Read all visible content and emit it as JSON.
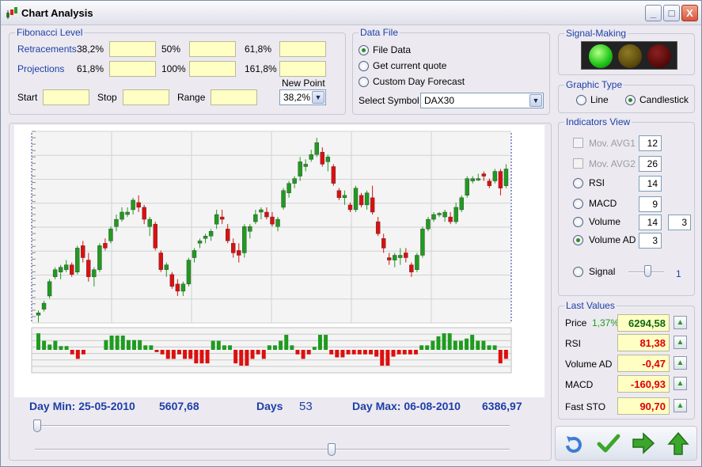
{
  "window": {
    "title": "Chart Analysis",
    "minimize": "_",
    "maximize": "□",
    "close": "X"
  },
  "fibonacci": {
    "legend": "Fibonacci Level",
    "retracements_label": "Retracements",
    "retracements": [
      "38,2%",
      "50%",
      "61,8%"
    ],
    "projections_label": "Projections",
    "projections": [
      "61,8%",
      "100%",
      "161,8%"
    ],
    "start_label": "Start",
    "stop_label": "Stop",
    "range_label": "Range",
    "new_point_label": "New Point",
    "new_point_value": "38,2%"
  },
  "data_file": {
    "legend": "Data File",
    "options": [
      "File Data",
      "Get current quote",
      "Custom Day Forecast"
    ],
    "selected": 0,
    "symbol_label": "Select Symbol",
    "symbol_value": "DAX30"
  },
  "signal": {
    "legend": "Signal-Making",
    "lights": [
      "green-on",
      "yellow-off",
      "red-off"
    ]
  },
  "graphic_type": {
    "legend": "Graphic Type",
    "options": [
      "Line",
      "Candlestick"
    ],
    "selected": 1
  },
  "indicators": {
    "legend": "Indicators View",
    "items": [
      {
        "label": "Mov. AVG1",
        "kind": "check",
        "value": "12",
        "enabled": false
      },
      {
        "label": "Mov. AVG2",
        "kind": "check",
        "value": "26",
        "enabled": false
      },
      {
        "label": "RSI",
        "kind": "radio",
        "value": "14"
      },
      {
        "label": "MACD",
        "kind": "radio",
        "value": "9"
      },
      {
        "label": "Volume",
        "kind": "radio",
        "value": "14",
        "value2": "3"
      },
      {
        "label": "Volume AD",
        "kind": "radio",
        "value": "3",
        "selected": true
      }
    ],
    "signal_label": "Signal",
    "signal_value": "1",
    "signal_level": 0.55
  },
  "last_values": {
    "legend": "Last Values",
    "price_label": "Price",
    "price_change": "1,37%",
    "price": "6294,58",
    "rsi_label": "RSI",
    "rsi": "81,38",
    "vad_label": "Volume AD",
    "vad": "-0,47",
    "macd_label": "MACD",
    "macd": "-160,93",
    "fsto_label": "Fast STO",
    "fsto": "90,70"
  },
  "stats": {
    "day_min": "Day Min: 25-05-2010",
    "min_value": "5607,68",
    "days_label": "Days",
    "days": "53",
    "day_max": "Day Max: 06-08-2010",
    "max_value": "6386,97"
  },
  "sliders": {
    "range_start": 0.0,
    "range_end": 0.63
  },
  "colors": {
    "up": "#1f9b1f",
    "down": "#dd0f0f",
    "accent": "#1e3ea8",
    "field": "#ffffc4"
  },
  "chart_data": {
    "type": "candlestick",
    "ylim": [
      5607.68,
      6386.97
    ],
    "candles": [
      [
        5640,
        5660,
        5610,
        5650
      ],
      [
        5665,
        5700,
        5655,
        5690
      ],
      [
        5720,
        5790,
        5710,
        5780
      ],
      [
        5800,
        5840,
        5790,
        5830
      ],
      [
        5820,
        5850,
        5790,
        5840
      ],
      [
        5830,
        5870,
        5820,
        5850
      ],
      [
        5850,
        5860,
        5800,
        5810
      ],
      [
        5820,
        5930,
        5810,
        5920
      ],
      [
        5930,
        5950,
        5860,
        5880
      ],
      [
        5870,
        5900,
        5780,
        5800
      ],
      [
        5800,
        5840,
        5760,
        5830
      ],
      [
        5830,
        5940,
        5820,
        5930
      ],
      [
        5940,
        5960,
        5910,
        5920
      ],
      [
        5950,
        6010,
        5940,
        6000
      ],
      [
        6010,
        6060,
        5990,
        6040
      ],
      [
        6040,
        6090,
        6030,
        6070
      ],
      [
        6060,
        6090,
        6050,
        6070
      ],
      [
        6080,
        6130,
        6060,
        6120
      ],
      [
        6110,
        6140,
        6070,
        6090
      ],
      [
        6090,
        6100,
        6020,
        6040
      ],
      [
        6010,
        6050,
        5970,
        6040
      ],
      [
        6020,
        6030,
        5910,
        5920
      ],
      [
        5900,
        5910,
        5820,
        5830
      ],
      [
        5830,
        5860,
        5800,
        5850
      ],
      [
        5810,
        5820,
        5750,
        5760
      ],
      [
        5770,
        5790,
        5720,
        5740
      ],
      [
        5740,
        5780,
        5720,
        5770
      ],
      [
        5770,
        5880,
        5760,
        5870
      ],
      [
        5880,
        5920,
        5860,
        5910
      ],
      [
        5940,
        5960,
        5920,
        5950
      ],
      [
        5960,
        5980,
        5940,
        5970
      ],
      [
        5970,
        6000,
        5950,
        5990
      ],
      [
        6020,
        6080,
        6000,
        6060
      ],
      [
        6050,
        6080,
        6020,
        6040
      ],
      [
        6000,
        6020,
        5940,
        5950
      ],
      [
        5940,
        5960,
        5880,
        5900
      ],
      [
        5910,
        5940,
        5860,
        5890
      ],
      [
        5900,
        6020,
        5880,
        6010
      ],
      [
        5990,
        6020,
        5960,
        6010
      ],
      [
        6030,
        6080,
        6020,
        6060
      ],
      [
        6070,
        6090,
        6040,
        6080
      ],
      [
        6070,
        6090,
        6040,
        6050
      ],
      [
        6050,
        6070,
        6010,
        6020
      ],
      [
        6010,
        6050,
        5990,
        6040
      ],
      [
        6090,
        6170,
        6080,
        6160
      ],
      [
        6150,
        6200,
        6130,
        6190
      ],
      [
        6190,
        6220,
        6170,
        6210
      ],
      [
        6220,
        6300,
        6200,
        6280
      ],
      [
        6260,
        6290,
        6240,
        6270
      ],
      [
        6290,
        6330,
        6280,
        6310
      ],
      [
        6310,
        6380,
        6300,
        6360
      ],
      [
        6320,
        6340,
        6260,
        6270
      ],
      [
        6280,
        6310,
        6240,
        6300
      ],
      [
        6260,
        6270,
        6180,
        6190
      ],
      [
        6160,
        6170,
        6120,
        6130
      ],
      [
        6130,
        6160,
        6100,
        6140
      ],
      [
        6100,
        6110,
        6070,
        6080
      ],
      [
        6080,
        6180,
        6070,
        6170
      ],
      [
        6140,
        6150,
        6090,
        6100
      ],
      [
        6100,
        6160,
        6080,
        6150
      ],
      [
        6130,
        6180,
        6060,
        6070
      ],
      [
        6030,
        6050,
        5970,
        5980
      ],
      [
        5960,
        5980,
        5900,
        5920
      ],
      [
        5880,
        5900,
        5850,
        5870
      ],
      [
        5870,
        5900,
        5840,
        5890
      ],
      [
        5880,
        5920,
        5850,
        5890
      ],
      [
        5900,
        5920,
        5860,
        5880
      ],
      [
        5850,
        5860,
        5800,
        5820
      ],
      [
        5830,
        5900,
        5820,
        5890
      ],
      [
        5890,
        6010,
        5880,
        6000
      ],
      [
        6000,
        6050,
        5990,
        6040
      ],
      [
        6040,
        6070,
        6030,
        6060
      ],
      [
        6060,
        6070,
        6050,
        6065
      ],
      [
        6050,
        6080,
        6030,
        6070
      ],
      [
        6050,
        6070,
        6020,
        6030
      ],
      [
        6030,
        6110,
        6020,
        6090
      ],
      [
        6080,
        6140,
        6070,
        6130
      ],
      [
        6140,
        6220,
        6130,
        6210
      ],
      [
        6200,
        6220,
        6190,
        6210
      ],
      [
        6210,
        6230,
        6200,
        6210
      ],
      [
        6230,
        6240,
        6200,
        6220
      ],
      [
        6200,
        6210,
        6170,
        6180
      ],
      [
        6200,
        6250,
        6190,
        6240
      ],
      [
        6240,
        6250,
        6140,
        6170
      ],
      [
        6180,
        6270,
        6170,
        6250
      ]
    ],
    "indicator": [
      0.22,
      0.12,
      0.07,
      0.12,
      0.05,
      0.05,
      -0.06,
      -0.12,
      -0.06,
      0.0,
      0.0,
      0.0,
      0.13,
      0.19,
      0.19,
      0.19,
      0.13,
      0.13,
      0.13,
      0.06,
      0.06,
      -0.03,
      -0.06,
      -0.12,
      -0.12,
      -0.06,
      -0.12,
      -0.12,
      -0.18,
      -0.18,
      -0.18,
      0.12,
      0.12,
      0.06,
      0.06,
      -0.18,
      -0.21,
      -0.21,
      -0.12,
      -0.06,
      -0.12,
      0.06,
      0.06,
      0.12,
      0.2,
      0.06,
      -0.06,
      -0.12,
      -0.06,
      0.04,
      0.2,
      0.2,
      -0.06,
      -0.1,
      -0.1,
      -0.06,
      -0.06,
      -0.06,
      -0.06,
      -0.06,
      -0.09,
      -0.21,
      -0.21,
      -0.09,
      -0.06,
      -0.06,
      -0.06,
      -0.06,
      0.06,
      0.06,
      0.12,
      0.18,
      0.22,
      0.22,
      0.12,
      0.12,
      0.15,
      0.2,
      0.12,
      0.12,
      0.06,
      0.06,
      -0.18,
      -0.12
    ]
  }
}
